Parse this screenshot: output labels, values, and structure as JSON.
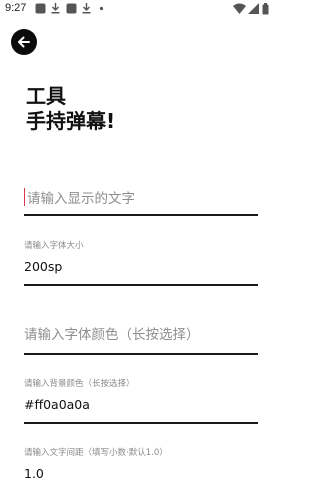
{
  "status_bar": {
    "time": "9:27",
    "notification_icons": [
      "app-icon",
      "download-icon",
      "app-icon",
      "download-icon",
      "dot-icon"
    ],
    "system_icons": [
      "wifi-icon",
      "signal-icon",
      "battery-icon"
    ]
  },
  "header": {
    "back_icon": "arrow-left-icon"
  },
  "title": {
    "line1": "工具",
    "line2": "手持弹幕!"
  },
  "fields": {
    "display_text": {
      "placeholder": "请输入显示的文字"
    },
    "font_size": {
      "label": "请输入字体大小",
      "value": "200sp"
    },
    "font_color": {
      "placeholder": "请输入字体颜色（长按选择）"
    },
    "bg_color": {
      "label": "请输入背景颜色（长按选择）",
      "value": "#ff0a0a0a"
    },
    "letter_spacing": {
      "label": "请输入文字间距（填写小数·默认1.0）",
      "value": "1.0"
    }
  },
  "colors": {
    "accent_cursor": "#d9354f",
    "button_bg": "#0c0c0c",
    "underline": "#1a1a1a"
  }
}
